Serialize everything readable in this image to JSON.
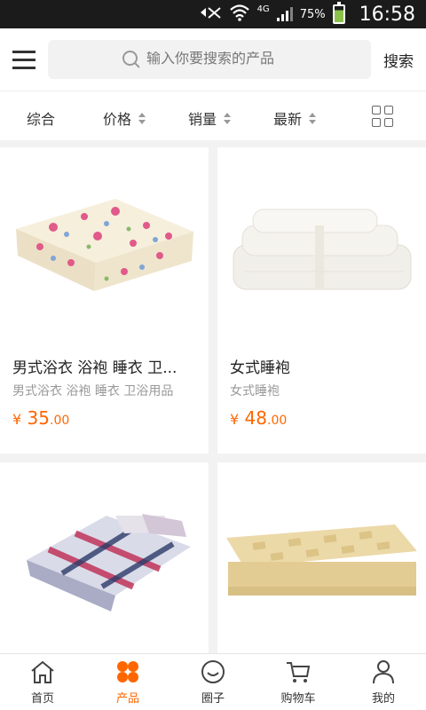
{
  "status": {
    "battery": "75%",
    "time": "16:58",
    "network": "4G"
  },
  "header": {
    "search_placeholder": "输入你要搜索的产品",
    "search_button": "搜索"
  },
  "sort": {
    "items": [
      "综合",
      "价格",
      "销量",
      "最新"
    ]
  },
  "products": [
    {
      "title": "男式浴衣 浴袍 睡衣 卫...",
      "subtitle": "男式浴衣 浴袍 睡衣 卫浴用品",
      "currency": "¥",
      "price_int": "35",
      "price_dec": ".00"
    },
    {
      "title": "女式睡袍",
      "subtitle": "女式睡袍",
      "currency": "¥",
      "price_int": "48",
      "price_dec": ".00"
    }
  ],
  "nav": {
    "items": [
      "首页",
      "产品",
      "圈子",
      "购物车",
      "我的"
    ],
    "active": "产品"
  },
  "colors": {
    "accent": "#ff6600"
  }
}
